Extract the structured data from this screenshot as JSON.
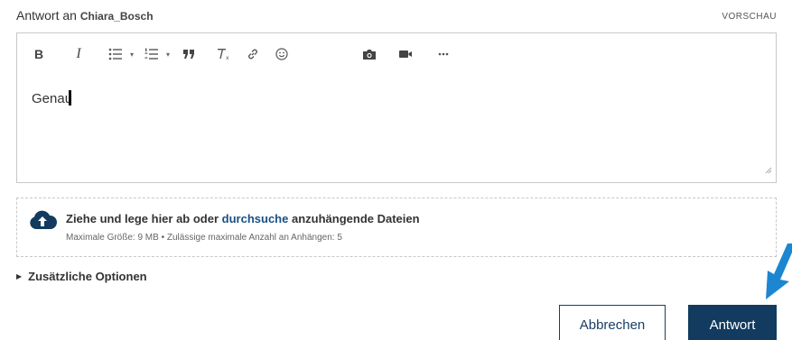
{
  "header": {
    "title_prefix": "Antwort an",
    "user": "Chiara_Bosch",
    "preview_label": "VORSCHAU"
  },
  "toolbar": {
    "bold": "B",
    "italic": "I",
    "caret": "▾",
    "items": [
      "bold",
      "italic",
      "bulleted-list",
      "numbered-list",
      "quote",
      "clear-formatting",
      "link",
      "emoji",
      "photo",
      "video",
      "more"
    ]
  },
  "editor": {
    "text": "Genau"
  },
  "dropzone": {
    "text_before": "Ziehe und lege hier ab oder",
    "link": "durchsuche",
    "text_after": "anzuhängende Dateien",
    "limits": "Maximale Größe: 9 MB • Zulässige maximale Anzahl an Anhängen: 5"
  },
  "options": {
    "label": "Zusätzliche Optionen"
  },
  "buttons": {
    "cancel": "Abbrechen",
    "submit": "Antwort"
  },
  "colors": {
    "primary": "#123b5f",
    "link": "#1a4f84",
    "pointer": "#1c86d1"
  }
}
